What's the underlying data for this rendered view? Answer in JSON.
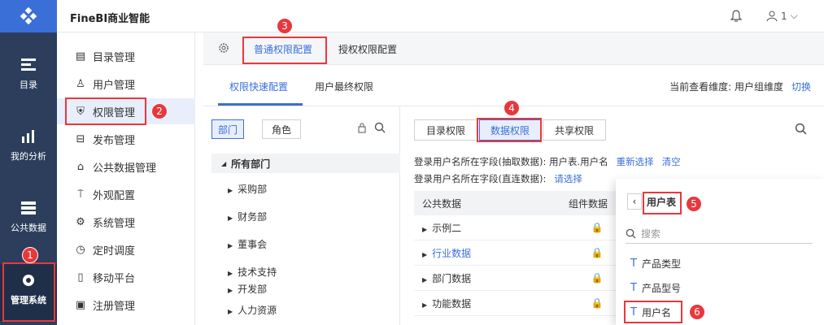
{
  "app": {
    "brand": "FineBI商业智能"
  },
  "user": {
    "name": "1"
  },
  "leftnav": [
    {
      "label": "目录"
    },
    {
      "label": "我的分析"
    },
    {
      "label": "公共数据"
    },
    {
      "label": "管理系统"
    }
  ],
  "sidemenu": [
    {
      "label": "目录管理"
    },
    {
      "label": "用户管理"
    },
    {
      "label": "权限管理"
    },
    {
      "label": "发布管理"
    },
    {
      "label": "公共数据管理"
    },
    {
      "label": "外观配置"
    },
    {
      "label": "系统管理"
    },
    {
      "label": "定时调度"
    },
    {
      "label": "移动平台"
    },
    {
      "label": "注册管理"
    }
  ],
  "tabs1": [
    {
      "label": "普通权限配置"
    },
    {
      "label": "授权权限配置"
    }
  ],
  "tabs2": [
    {
      "label": "权限快速配置"
    },
    {
      "label": "用户最终权限"
    }
  ],
  "dimension": {
    "label": "当前查看维度: 用户组维度",
    "switch": "切换"
  },
  "seg": [
    {
      "label": "部门"
    },
    {
      "label": "角色"
    }
  ],
  "tree": {
    "root": "所有部门",
    "nodes": [
      "采购部",
      "财务部",
      "董事会",
      "技术支持",
      "开发部",
      "人力资源"
    ]
  },
  "tabs3": [
    {
      "label": "目录权限"
    },
    {
      "label": "数据权限"
    },
    {
      "label": "共享权限"
    }
  ],
  "info": {
    "line1": "登录用户名所在字段(抽取数据): 用户表.用户名",
    "reselect": "重新选择",
    "clear": "清空",
    "line2": "登录用户名所在字段(直连数据):",
    "select": "请选择"
  },
  "table": {
    "col1": "公共数据",
    "col2": "组件数据",
    "rows": [
      "示例二",
      "行业数据",
      "部门数据",
      "功能数据"
    ]
  },
  "popup": {
    "title": "用户表",
    "search_placeholder": "搜索",
    "fields": [
      "产品类型",
      "产品型号",
      "用户名"
    ]
  },
  "badges": [
    "1",
    "2",
    "3",
    "4",
    "5",
    "6"
  ],
  "colors": {
    "accent": "#3a6fd8",
    "nav": "#2c3e5c",
    "highlight": "#e8383d"
  }
}
